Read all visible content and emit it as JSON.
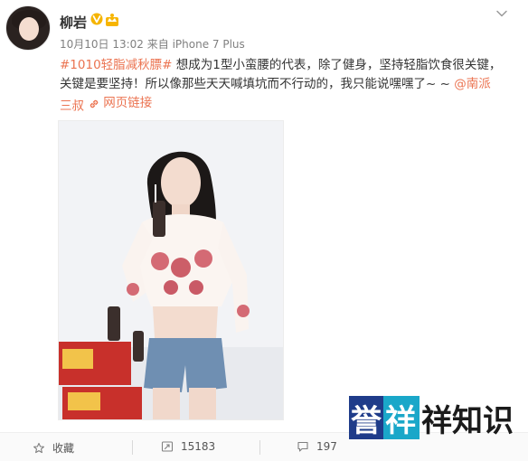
{
  "post": {
    "author": "柳岩",
    "meta": "10月10日 13:02 来自 iPhone 7 Plus",
    "hashtag": "#1010轻脂减秋膘#",
    "text_line1": " 想成为1型小蛮腰的代表，除了健身，坚持轻脂饮食很关键，",
    "text_line2": "关键是要坚持！所以像那些天天喊填坑而不行动的，我只能说嘿嘿了~ ~ ",
    "mention_part1": "@南派",
    "mention_part2": "三叔",
    "weblink_label": "网页链接"
  },
  "actions": {
    "favorite_label": "收藏",
    "repost_count": "15183",
    "comment_count": "197"
  },
  "watermark": {
    "text": "誉祥祥知识"
  },
  "colors": {
    "accent": "#eb7350",
    "verified_badge": "#f5b400",
    "watermark_blue": "#1f3c8a",
    "watermark_teal": "#1aa7c9"
  }
}
